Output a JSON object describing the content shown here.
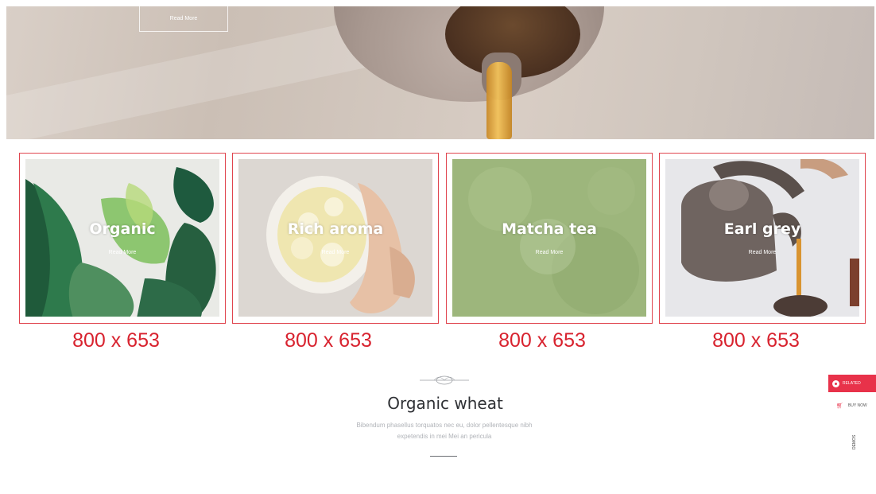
{
  "hero": {
    "button_label": "Read More"
  },
  "cards": [
    {
      "title": "Organic",
      "link": "Read More",
      "size": "800 x 653"
    },
    {
      "title": "Rich aroma",
      "link": "Read More",
      "size": "800 x 653"
    },
    {
      "title": "Matcha tea",
      "link": "Read More",
      "size": "800 x 653"
    },
    {
      "title": "Earl grey",
      "link": "Read More",
      "size": "800 x 653"
    }
  ],
  "section": {
    "title": "Organic wheat",
    "description_line1": "Bibendum phasellus torquatos nec eu, dolor pellentesque nibh",
    "description_line2": "expetendis in mei Mei an pericula"
  },
  "sidebar_widgets": {
    "primary_label": "RELATED",
    "cart_label": "BUY NOW",
    "vertical_label": "DEMOS"
  },
  "colors": {
    "accent": "#e8324a",
    "guide_border": "#e0454f",
    "size_label": "#d8232f",
    "heading": "#2f3135"
  }
}
